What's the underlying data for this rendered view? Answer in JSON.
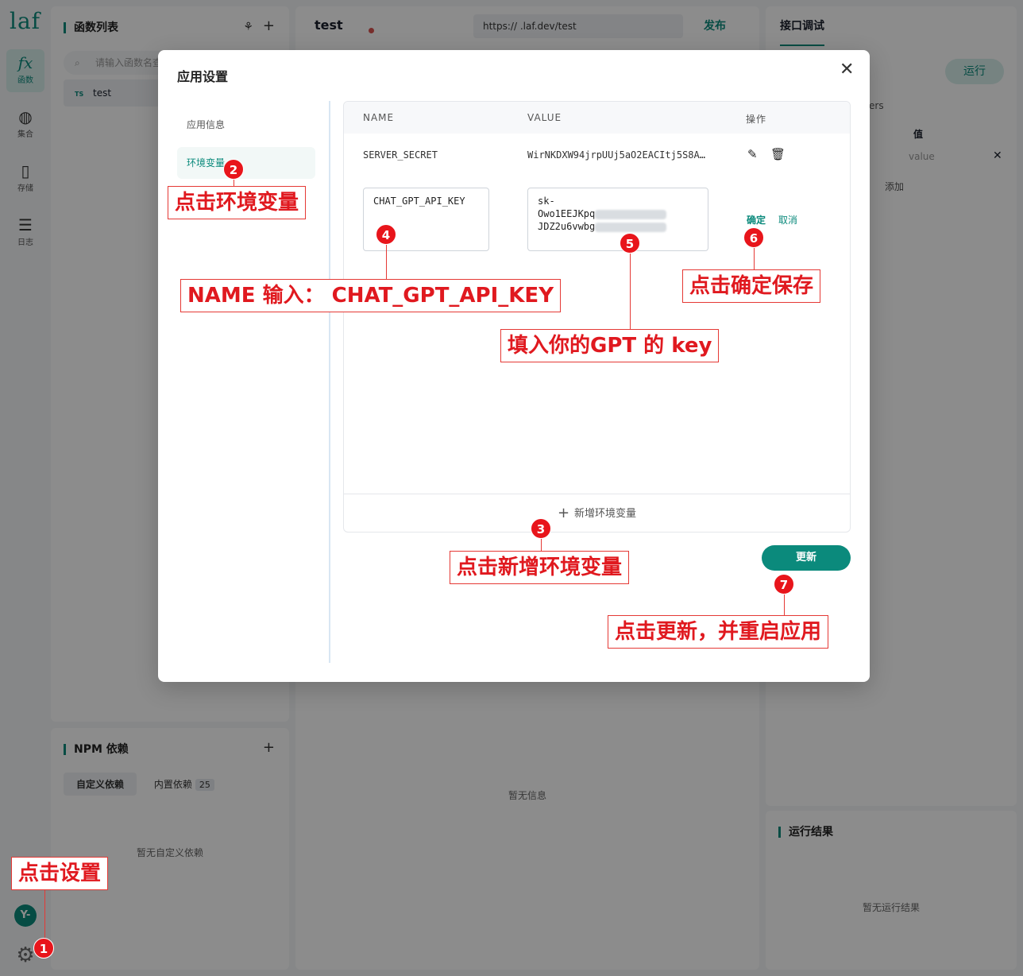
{
  "nav": {
    "logo": "laf",
    "items": [
      {
        "label": "函数",
        "icon": "fx"
      },
      {
        "label": "集合",
        "icon": "◍"
      },
      {
        "label": "存储",
        "icon": "▯"
      },
      {
        "label": "日志",
        "icon": "☰"
      }
    ],
    "avatar": "Y-"
  },
  "functions": {
    "title": "函数列表",
    "search_placeholder": "请输入函数名查",
    "items": [
      {
        "tag": "TS",
        "name": "test"
      }
    ]
  },
  "npm": {
    "title": "NPM 依赖",
    "tab_custom": "自定义依赖",
    "tab_builtin": "内置依赖",
    "builtin_count": "25",
    "empty": "暂无自定义依赖"
  },
  "editor": {
    "title": "test",
    "url": "https://       .laf.dev/test",
    "publish": "发布",
    "empty": "暂无信息"
  },
  "debug": {
    "tab": "接口调试",
    "run": "运行",
    "params_label": "ers",
    "col_value": "值",
    "value_placeholder": "value",
    "add": "添加"
  },
  "result": {
    "title": "运行结果",
    "empty": "暂无运行结果"
  },
  "modal": {
    "title": "应用设置",
    "menu": [
      "应用信息",
      "环境变量"
    ],
    "table": {
      "col_name": "NAME",
      "col_value": "VALUE",
      "col_action": "操作",
      "rows": [
        {
          "name": "SERVER_SECRET",
          "value": "WirNKDXW94jrpUUj5aO2EACItj5S8A..."
        }
      ],
      "editing": {
        "name": "CHAT_GPT_API_KEY",
        "value_line1": "sk-",
        "value_line2": "Owo1EEJKpq",
        "value_line3": "JDZ2u6vwbg"
      },
      "confirm": "确定",
      "cancel": "取消"
    },
    "add_env": "新增环境变量",
    "update": "更新"
  },
  "annotations": [
    {
      "num": "1",
      "text": "点击设置"
    },
    {
      "num": "2",
      "text": "点击环境变量"
    },
    {
      "num": "3",
      "text": "点击新增环境变量"
    },
    {
      "num": "4",
      "text": "NAME 输入： CHAT_GPT_API_KEY"
    },
    {
      "num": "5",
      "text": "填入你的GPT 的 key"
    },
    {
      "num": "6",
      "text": "点击确定保存"
    },
    {
      "num": "7",
      "text": "点击更新，并重启应用"
    }
  ]
}
